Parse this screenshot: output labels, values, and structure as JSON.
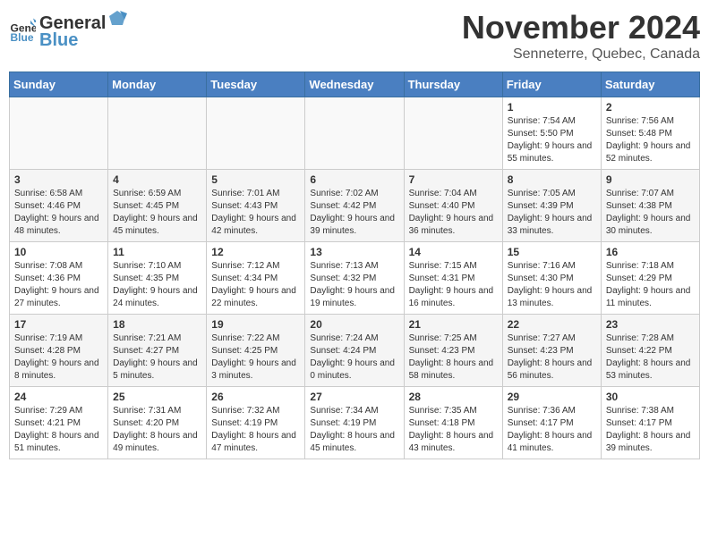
{
  "logo": {
    "general": "General",
    "blue": "Blue"
  },
  "title": "November 2024",
  "location": "Senneterre, Quebec, Canada",
  "weekdays": [
    "Sunday",
    "Monday",
    "Tuesday",
    "Wednesday",
    "Thursday",
    "Friday",
    "Saturday"
  ],
  "weeks": [
    [
      {
        "day": "",
        "info": ""
      },
      {
        "day": "",
        "info": ""
      },
      {
        "day": "",
        "info": ""
      },
      {
        "day": "",
        "info": ""
      },
      {
        "day": "",
        "info": ""
      },
      {
        "day": "1",
        "info": "Sunrise: 7:54 AM\nSunset: 5:50 PM\nDaylight: 9 hours and 55 minutes."
      },
      {
        "day": "2",
        "info": "Sunrise: 7:56 AM\nSunset: 5:48 PM\nDaylight: 9 hours and 52 minutes."
      }
    ],
    [
      {
        "day": "3",
        "info": "Sunrise: 6:58 AM\nSunset: 4:46 PM\nDaylight: 9 hours and 48 minutes."
      },
      {
        "day": "4",
        "info": "Sunrise: 6:59 AM\nSunset: 4:45 PM\nDaylight: 9 hours and 45 minutes."
      },
      {
        "day": "5",
        "info": "Sunrise: 7:01 AM\nSunset: 4:43 PM\nDaylight: 9 hours and 42 minutes."
      },
      {
        "day": "6",
        "info": "Sunrise: 7:02 AM\nSunset: 4:42 PM\nDaylight: 9 hours and 39 minutes."
      },
      {
        "day": "7",
        "info": "Sunrise: 7:04 AM\nSunset: 4:40 PM\nDaylight: 9 hours and 36 minutes."
      },
      {
        "day": "8",
        "info": "Sunrise: 7:05 AM\nSunset: 4:39 PM\nDaylight: 9 hours and 33 minutes."
      },
      {
        "day": "9",
        "info": "Sunrise: 7:07 AM\nSunset: 4:38 PM\nDaylight: 9 hours and 30 minutes."
      }
    ],
    [
      {
        "day": "10",
        "info": "Sunrise: 7:08 AM\nSunset: 4:36 PM\nDaylight: 9 hours and 27 minutes."
      },
      {
        "day": "11",
        "info": "Sunrise: 7:10 AM\nSunset: 4:35 PM\nDaylight: 9 hours and 24 minutes."
      },
      {
        "day": "12",
        "info": "Sunrise: 7:12 AM\nSunset: 4:34 PM\nDaylight: 9 hours and 22 minutes."
      },
      {
        "day": "13",
        "info": "Sunrise: 7:13 AM\nSunset: 4:32 PM\nDaylight: 9 hours and 19 minutes."
      },
      {
        "day": "14",
        "info": "Sunrise: 7:15 AM\nSunset: 4:31 PM\nDaylight: 9 hours and 16 minutes."
      },
      {
        "day": "15",
        "info": "Sunrise: 7:16 AM\nSunset: 4:30 PM\nDaylight: 9 hours and 13 minutes."
      },
      {
        "day": "16",
        "info": "Sunrise: 7:18 AM\nSunset: 4:29 PM\nDaylight: 9 hours and 11 minutes."
      }
    ],
    [
      {
        "day": "17",
        "info": "Sunrise: 7:19 AM\nSunset: 4:28 PM\nDaylight: 9 hours and 8 minutes."
      },
      {
        "day": "18",
        "info": "Sunrise: 7:21 AM\nSunset: 4:27 PM\nDaylight: 9 hours and 5 minutes."
      },
      {
        "day": "19",
        "info": "Sunrise: 7:22 AM\nSunset: 4:25 PM\nDaylight: 9 hours and 3 minutes."
      },
      {
        "day": "20",
        "info": "Sunrise: 7:24 AM\nSunset: 4:24 PM\nDaylight: 9 hours and 0 minutes."
      },
      {
        "day": "21",
        "info": "Sunrise: 7:25 AM\nSunset: 4:23 PM\nDaylight: 8 hours and 58 minutes."
      },
      {
        "day": "22",
        "info": "Sunrise: 7:27 AM\nSunset: 4:23 PM\nDaylight: 8 hours and 56 minutes."
      },
      {
        "day": "23",
        "info": "Sunrise: 7:28 AM\nSunset: 4:22 PM\nDaylight: 8 hours and 53 minutes."
      }
    ],
    [
      {
        "day": "24",
        "info": "Sunrise: 7:29 AM\nSunset: 4:21 PM\nDaylight: 8 hours and 51 minutes."
      },
      {
        "day": "25",
        "info": "Sunrise: 7:31 AM\nSunset: 4:20 PM\nDaylight: 8 hours and 49 minutes."
      },
      {
        "day": "26",
        "info": "Sunrise: 7:32 AM\nSunset: 4:19 PM\nDaylight: 8 hours and 47 minutes."
      },
      {
        "day": "27",
        "info": "Sunrise: 7:34 AM\nSunset: 4:19 PM\nDaylight: 8 hours and 45 minutes."
      },
      {
        "day": "28",
        "info": "Sunrise: 7:35 AM\nSunset: 4:18 PM\nDaylight: 8 hours and 43 minutes."
      },
      {
        "day": "29",
        "info": "Sunrise: 7:36 AM\nSunset: 4:17 PM\nDaylight: 8 hours and 41 minutes."
      },
      {
        "day": "30",
        "info": "Sunrise: 7:38 AM\nSunset: 4:17 PM\nDaylight: 8 hours and 39 minutes."
      }
    ]
  ]
}
